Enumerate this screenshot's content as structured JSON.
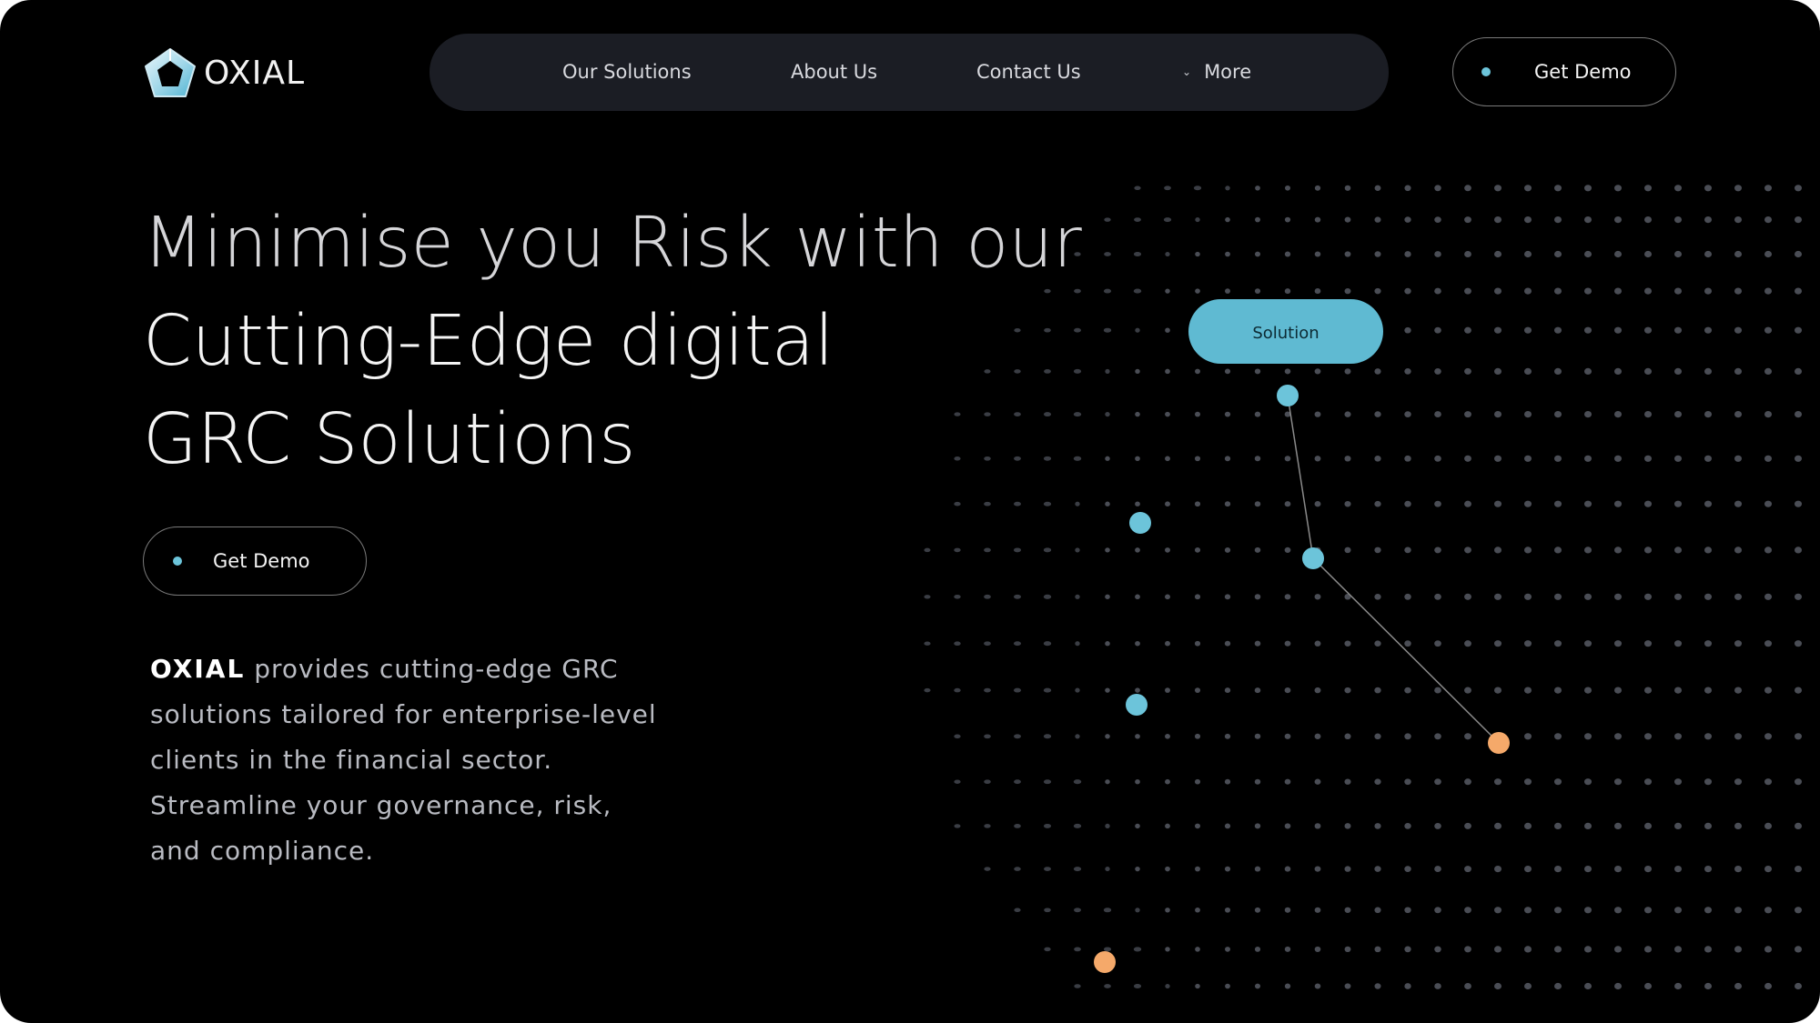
{
  "brand": {
    "name": "OXIAL",
    "colors": {
      "accent": "#6cc4da",
      "highlight": "#f5a96a",
      "background": "#000000",
      "nav_bg": "#1b1d24"
    }
  },
  "nav": {
    "items": [
      {
        "label": "Our Solutions"
      },
      {
        "label": "About Us"
      },
      {
        "label": "Contact Us"
      },
      {
        "label": "More",
        "icon": "chevron-down-icon"
      }
    ]
  },
  "header_cta": {
    "label": "Get Demo"
  },
  "hero": {
    "headline_lines": [
      "Minimise you Risk with our",
      "Cutting-Edge digital",
      "GRC Solutions"
    ],
    "cta_label": "Get Demo",
    "description_brand": "OXIAL",
    "description_text": " provides cutting-edge GRC solutions tailored for enterprise-level clients in the financial sector. Streamline your governance, risk, and compliance."
  },
  "globe": {
    "tag_label": "Solution"
  }
}
